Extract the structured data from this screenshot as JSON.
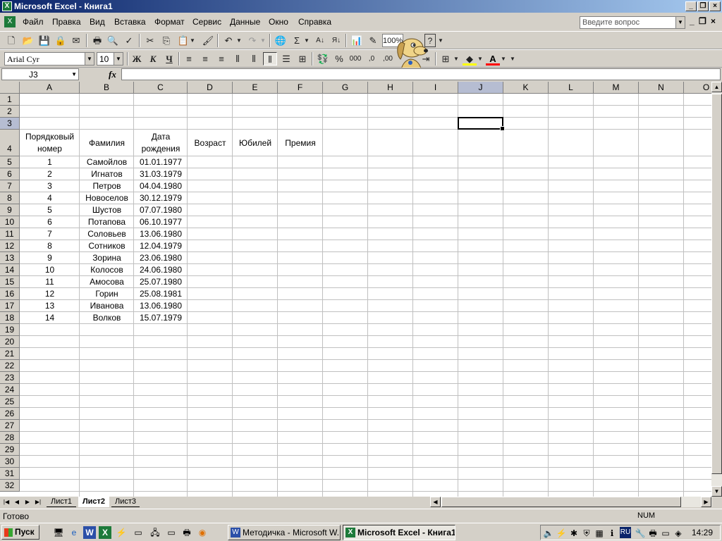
{
  "window": {
    "title": "Microsoft Excel - Книга1"
  },
  "menu": [
    "Файл",
    "Правка",
    "Вид",
    "Вставка",
    "Формат",
    "Сервис",
    "Данные",
    "Окно",
    "Справка"
  ],
  "ask_placeholder": "Введите вопрос",
  "toolbar": {
    "zoom": "100%",
    "font_name": "Arial Cyr",
    "font_size": "10",
    "bold": "Ж",
    "italic": "К",
    "underline": "Ч",
    "sum": "Σ",
    "percent": "%",
    "thousands": "000"
  },
  "formula": {
    "name_box": "J3",
    "fx": "fx"
  },
  "columns": [
    "A",
    "B",
    "C",
    "D",
    "E",
    "F",
    "G",
    "H",
    "I",
    "J",
    "K",
    "L",
    "M",
    "N",
    "O"
  ],
  "rows": [
    "1",
    "2",
    "3",
    "4",
    "5",
    "6",
    "7",
    "8",
    "9",
    "10",
    "11",
    "12",
    "13",
    "14",
    "15",
    "16",
    "17",
    "18",
    "19",
    "20",
    "21",
    "22",
    "23",
    "24",
    "25",
    "26",
    "27",
    "28",
    "29",
    "30",
    "31",
    "32"
  ],
  "selected_cell": "J3",
  "table": {
    "headers": [
      "Порядковый номер",
      "Фамилия",
      "Дата рождения",
      "Возраст",
      "Юбилей",
      "Премия"
    ],
    "data": [
      [
        "1",
        "Самойлов",
        "01.01.1977"
      ],
      [
        "2",
        "Игнатов",
        "31.03.1979"
      ],
      [
        "3",
        "Петров",
        "04.04.1980"
      ],
      [
        "4",
        "Новоселов",
        "30.12.1979"
      ],
      [
        "5",
        "Шустов",
        "07.07.1980"
      ],
      [
        "6",
        "Потапова",
        "06.10.1977"
      ],
      [
        "7",
        "Соловьев",
        "13.06.1980"
      ],
      [
        "8",
        "Сотников",
        "12.04.1979"
      ],
      [
        "9",
        "Зорина",
        "23.06.1980"
      ],
      [
        "10",
        "Колосов",
        "24.06.1980"
      ],
      [
        "11",
        "Амосова",
        "25.07.1980"
      ],
      [
        "12",
        "Горин",
        "25.08.1981"
      ],
      [
        "13",
        "Иванова",
        "13.06.1980"
      ],
      [
        "14",
        "Волков",
        "15.07.1979"
      ]
    ]
  },
  "sheets": [
    "Лист1",
    "Лист2",
    "Лист3"
  ],
  "active_sheet": "Лист2",
  "status": {
    "text": "Готово",
    "num": "NUM"
  },
  "taskbar": {
    "start": "Пуск",
    "items": [
      "Методичка - Microsoft W...",
      "Microsoft Excel - Книга1"
    ],
    "lang": "RU",
    "clock": "14:29"
  }
}
